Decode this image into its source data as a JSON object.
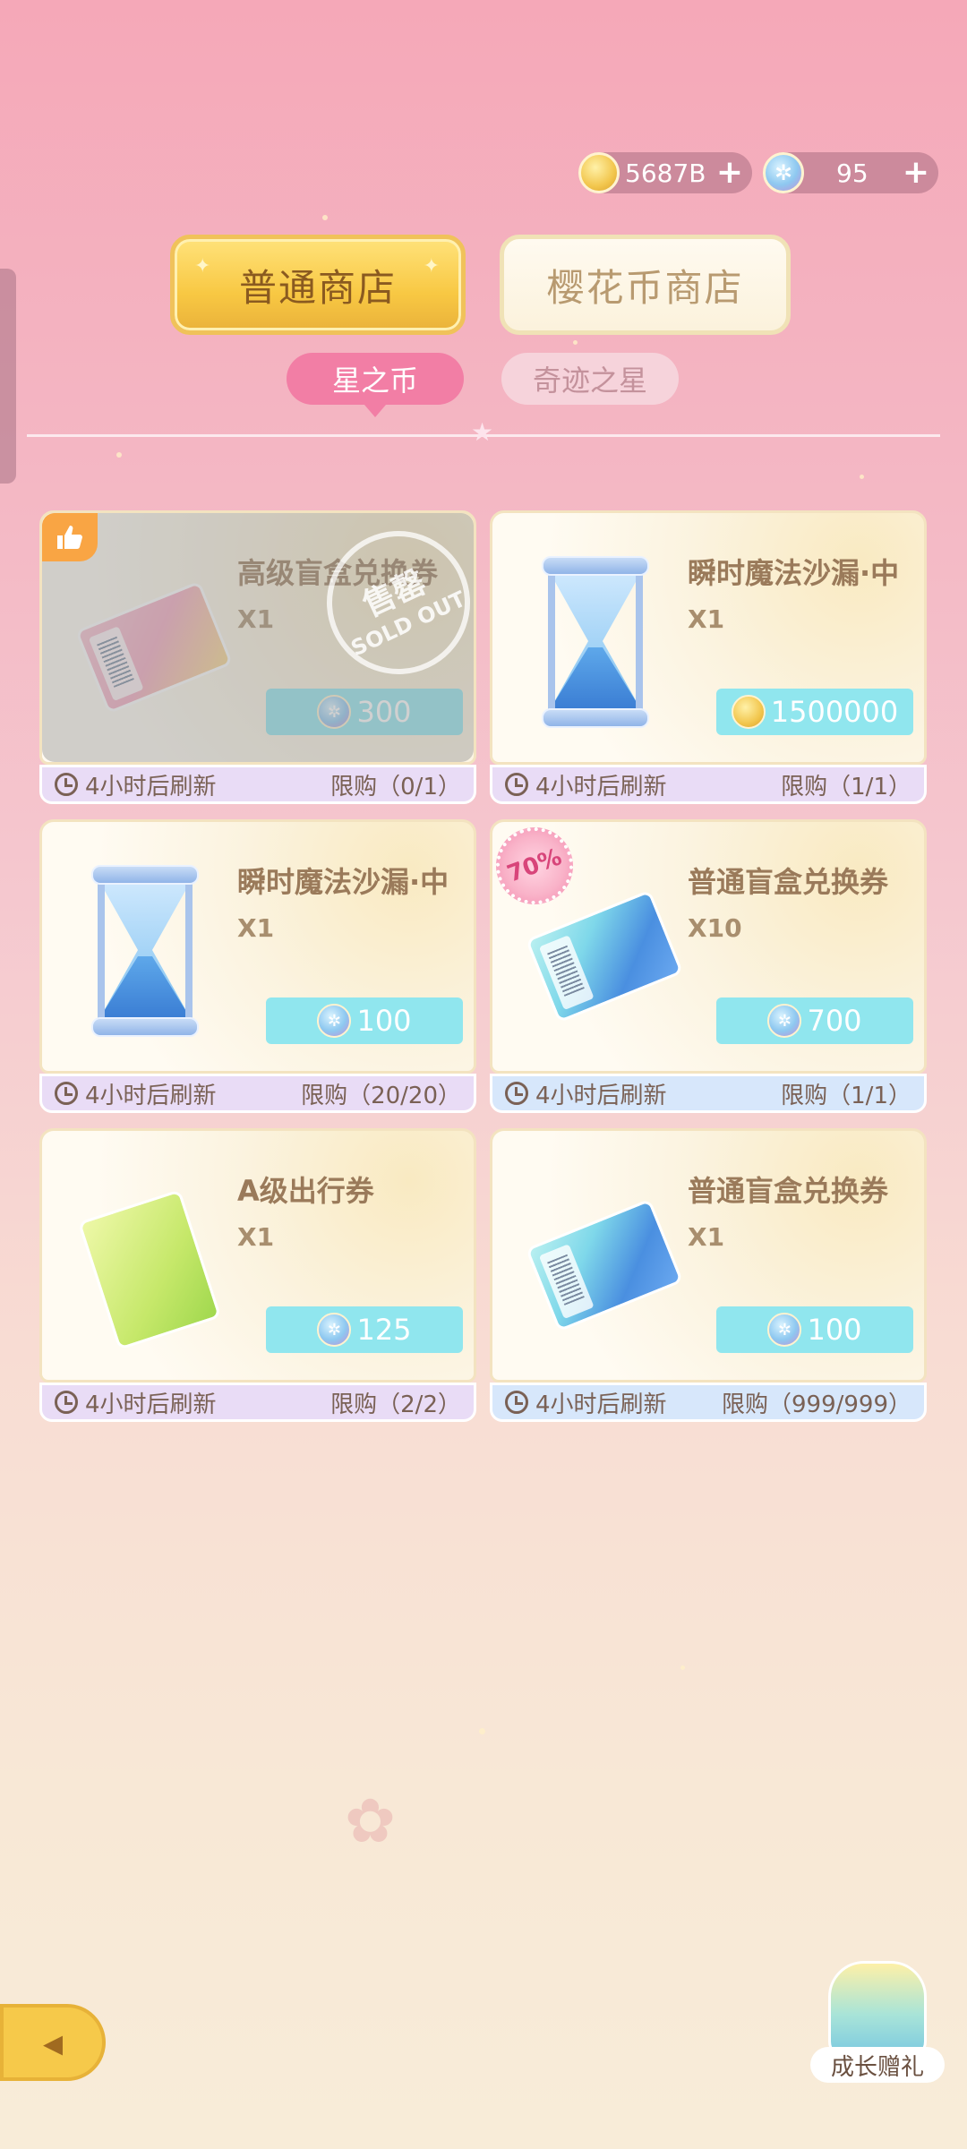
{
  "currency": {
    "coins": "5687B",
    "stars": "95"
  },
  "shop_tabs": {
    "normal": "普通商店",
    "sakura": "樱花币商店"
  },
  "sub_tabs": {
    "star_coin": "星之币",
    "miracle_star": "奇迹之星"
  },
  "items": [
    {
      "title": "高级盲盒兑换券",
      "qty": "X1",
      "price": "300",
      "currency": "star",
      "refresh": "4小时后刷新",
      "limit": "限购（0/1）",
      "sold_out": true,
      "badge": "thumb",
      "footer": "purple"
    },
    {
      "title": "瞬时魔法沙漏·中",
      "qty": "X1",
      "price": "1500000",
      "currency": "coin",
      "refresh": "4小时后刷新",
      "limit": "限购（1/1）",
      "sold_out": false,
      "footer": "purple"
    },
    {
      "title": "瞬时魔法沙漏·中",
      "qty": "X1",
      "price": "100",
      "currency": "star",
      "refresh": "4小时后刷新",
      "limit": "限购（20/20）",
      "sold_out": false,
      "footer": "purple"
    },
    {
      "title": "普通盲盒兑换券",
      "qty": "X10",
      "price": "700",
      "currency": "star",
      "refresh": "4小时后刷新",
      "limit": "限购（1/1）",
      "sold_out": false,
      "badge": "discount",
      "footer": "blue"
    },
    {
      "title": "A级出行券",
      "qty": "X1",
      "price": "125",
      "currency": "star",
      "refresh": "4小时后刷新",
      "limit": "限购（2/2）",
      "sold_out": false,
      "footer": "purple"
    },
    {
      "title": "普通盲盒兑换券",
      "qty": "X1",
      "price": "100",
      "currency": "star",
      "refresh": "4小时后刷新",
      "limit": "限购（999/999）",
      "sold_out": false,
      "footer": "blue"
    }
  ],
  "soldout_stamp": {
    "cn": "售罄",
    "en": "SOLD OUT"
  },
  "discount_badge": "70%",
  "growth_gift": "成长赠礼"
}
